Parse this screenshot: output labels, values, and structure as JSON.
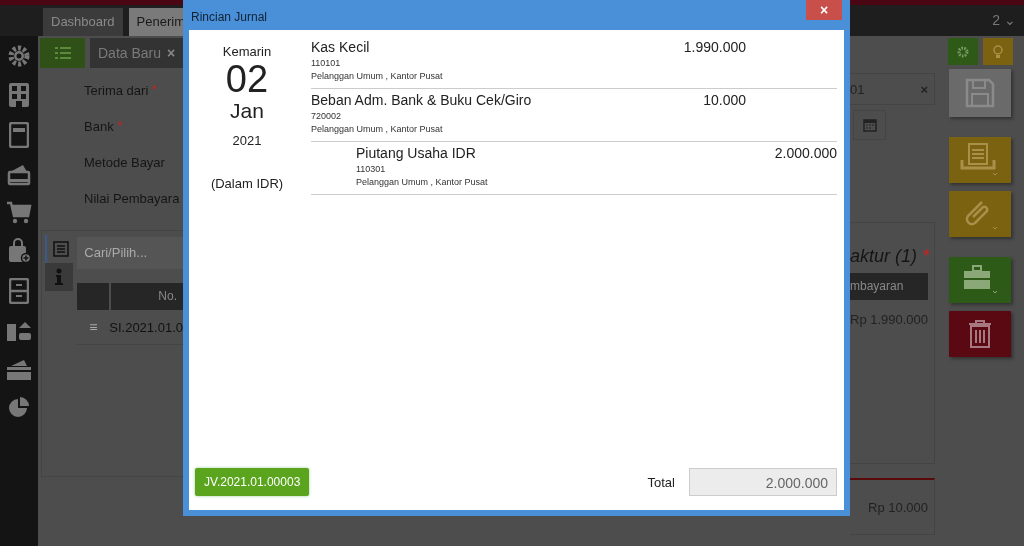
{
  "app": {
    "tabs": [
      {
        "label": "Dashboard",
        "selected": false
      },
      {
        "label": "Penerim",
        "selected": true
      }
    ],
    "window_count": "2 ⌄",
    "subtab": {
      "label": "Data Baru",
      "close": "×"
    },
    "form_labels": [
      {
        "label": "Terima dari",
        "mark": "*"
      },
      {
        "label": "Bank",
        "mark": "*"
      },
      {
        "label": "Metode Bayar"
      },
      {
        "label": "Nilai Pembayara"
      }
    ],
    "customer_field": {
      "value": "01",
      "clear": "×"
    },
    "search": {
      "placeholder": "Cari/Pilih..."
    },
    "invoice_heading": "aktur (1)",
    "invoice_required": "*",
    "table": {
      "columns": [
        "No.",
        "mbayaran"
      ],
      "rows": [
        {
          "handle": "≡",
          "number": "SI.2021.01.0",
          "amount": "Rp 1.990.000"
        }
      ]
    },
    "summary": "Rp 10.000"
  },
  "dialog": {
    "title": "Rincian Jurnal",
    "close": "×",
    "date": {
      "relative": "Kemarin",
      "day": "02",
      "month": "Jan",
      "year": "2021",
      "currency": "(Dalam IDR)"
    },
    "entries": [
      {
        "kind": "debit",
        "account": "Kas Kecil",
        "code": "110101",
        "detail": "Pelanggan Umum , Kantor Pusat",
        "amount": "1.990.000"
      },
      {
        "kind": "debit",
        "account": "Beban Adm. Bank & Buku Cek/Giro",
        "code": "720002",
        "detail": "Pelanggan Umum , Kantor Pusat",
        "amount": "10.000"
      },
      {
        "kind": "credit",
        "account": "Piutang Usaha IDR",
        "code": "110301",
        "detail": "Pelanggan Umum , Kantor Pusat",
        "amount": "2.000.000"
      }
    ],
    "journal_button": "JV.2021.01.00003",
    "total_label": "Total",
    "total": "2.000.000"
  }
}
